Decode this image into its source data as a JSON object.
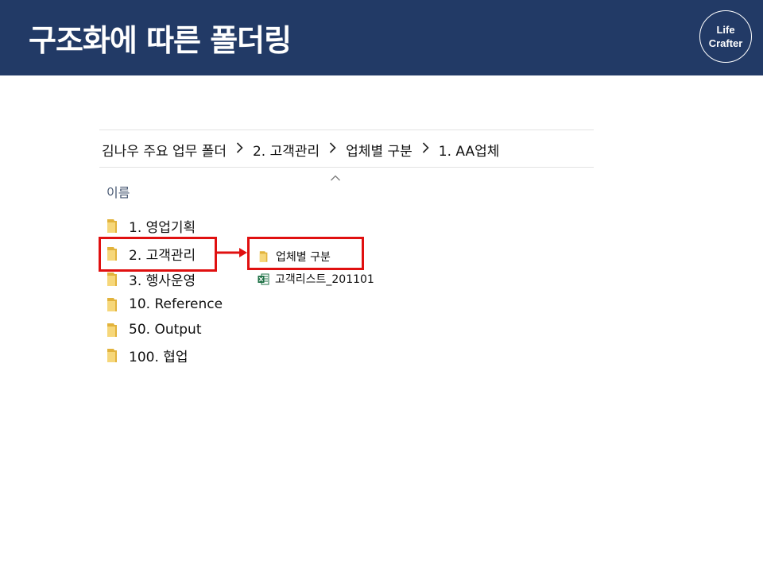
{
  "slide": {
    "title": "구조화에 따른 폴더링",
    "logo_line1": "Life",
    "logo_line2": "Crafter"
  },
  "breadcrumb": [
    {
      "label": "김나우  주요 업무 폴더"
    },
    {
      "label": "2. 고객관리"
    },
    {
      "label": "업체별 구분"
    },
    {
      "label": "1. AA업체"
    }
  ],
  "file_list": {
    "column_header": "이름",
    "sort_icon": "chevron-up-icon",
    "items": [
      {
        "label": "1. 영업기획",
        "icon": "folder-icon"
      },
      {
        "label": "2. 고객관리",
        "icon": "folder-icon"
      },
      {
        "label": "3. 행사운영",
        "icon": "folder-icon"
      },
      {
        "label": "10. Reference",
        "icon": "folder-icon"
      },
      {
        "label": "50. Output",
        "icon": "folder-icon"
      },
      {
        "label": "100. 협업",
        "icon": "folder-icon"
      }
    ]
  },
  "subfolder": {
    "items": [
      {
        "label": "업체별 구분",
        "icon": "folder-icon"
      },
      {
        "label": "고객리스트_201101",
        "icon": "excel-icon"
      }
    ]
  },
  "colors": {
    "header_bg": "#223a66",
    "highlight": "#e01010",
    "folder": "#f2c94c"
  }
}
